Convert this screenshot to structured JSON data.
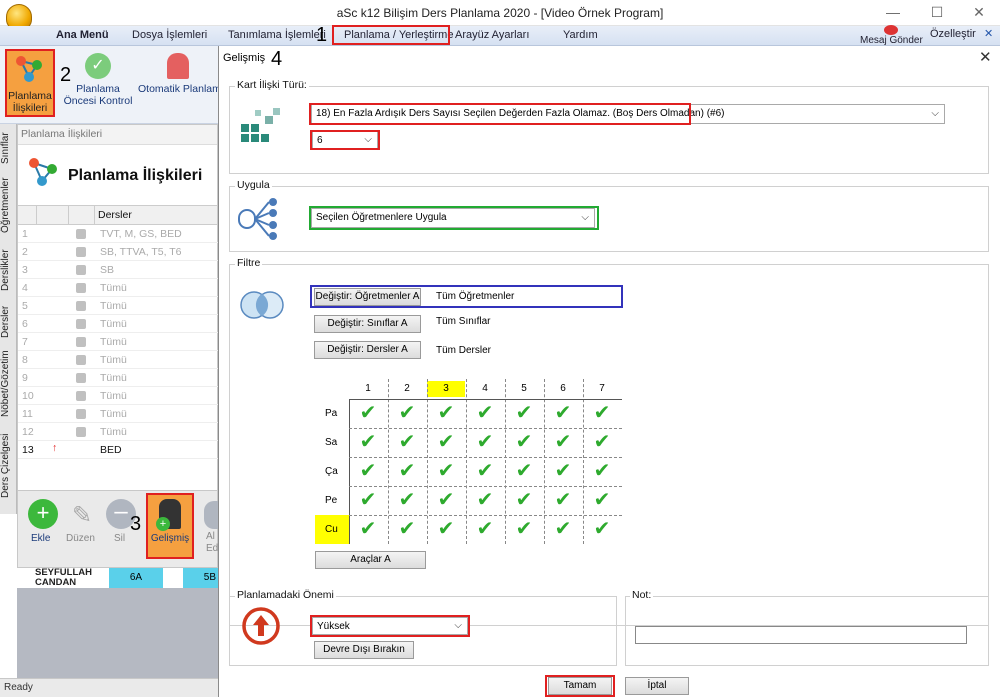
{
  "window": {
    "title": "aSc k12 Bilişim Ders Planlama 2020  - [Video Örnek Program]",
    "minimize": "—",
    "maximize": "☐",
    "close": "✕"
  },
  "menubar": {
    "items": [
      "Ana Menü",
      "Dosya İşlemleri",
      "Tanımlama İşlemleri",
      "Planlama / Yerleştirme",
      "Arayüz Ayarları",
      "Yardım"
    ],
    "send_message": "Mesaj Gönder",
    "customize": "Özelleştir"
  },
  "annotations": {
    "step1": "1",
    "step2": "2",
    "step3": "3",
    "step4": "4"
  },
  "ribbon": {
    "btn1": "Planlama İlişkileri",
    "btn2": "Planlama Öncesi Kontrol",
    "btn3": "Otomatik Planlamayı Başlat"
  },
  "vertical_tabs": [
    "Sınıflar",
    "Öğretmenler",
    "Derslikler",
    "Dersler",
    "Nöbet/Gözetim",
    "Ders Çizelgesi"
  ],
  "left_panel": {
    "header": "Planlama İlişkileri",
    "title": "Planlama İlişkileri",
    "column": "Dersler",
    "rows": [
      {
        "n": "1",
        "text": "TVT, M, GS, BED"
      },
      {
        "n": "2",
        "text": "SB, TTVA, T5, T6"
      },
      {
        "n": "3",
        "text": "SB"
      },
      {
        "n": "4",
        "text": "Tümü"
      },
      {
        "n": "5",
        "text": "Tümü"
      },
      {
        "n": "6",
        "text": "Tümü"
      },
      {
        "n": "7",
        "text": "Tümü"
      },
      {
        "n": "8",
        "text": "Tümü"
      },
      {
        "n": "9",
        "text": "Tümü"
      },
      {
        "n": "10",
        "text": "Tümü"
      },
      {
        "n": "11",
        "text": "Tümü"
      },
      {
        "n": "12",
        "text": "Tümü"
      },
      {
        "n": "13",
        "text": "BED"
      }
    ],
    "buttons": {
      "add": "Ekle",
      "edit": "Düzen",
      "delete": "Sil",
      "advanced": "Gelişmiş",
      "more": "Al Ed"
    }
  },
  "schedule_strip": {
    "teacher": "SEYFULLAH CANDAN",
    "c1": "6A",
    "c2": "5B"
  },
  "status": "Ready",
  "dialog": {
    "title": "Gelişmiş",
    "close": "✕",
    "card_type": {
      "label": "Kart İlişki Türü:",
      "value": "18) En Fazla Ardışık Ders Sayısı Seçilen Değerden Fazla Olamaz. (Boş Ders Olmadan) (#6)",
      "count": "6"
    },
    "apply": {
      "label": "Uygula",
      "value": "Seçilen Öğretmenlere Uygula"
    },
    "filter": {
      "label": "Filtre",
      "rows": [
        {
          "button": "Değiştir: Öğretmenler A",
          "value": "Tüm Öğretmenler"
        },
        {
          "button": "Değiştir: Sınıflar A",
          "value": "Tüm Sınıflar"
        },
        {
          "button": "Değiştir: Dersler A",
          "value": "Tüm Dersler"
        }
      ],
      "periods": [
        "1",
        "2",
        "3",
        "4",
        "5",
        "6",
        "7"
      ],
      "days": [
        "Pa",
        "Sa",
        "Ça",
        "Pe",
        "Cu"
      ],
      "highlight_period": "3",
      "highlight_day": "Cu",
      "check_icon": "✔",
      "tools": "Araçlar A"
    },
    "importance": {
      "label": "Planlamadaki Önemi",
      "value": "Yüksek",
      "disable": "Devre Dışı Bırakın"
    },
    "note": {
      "label": "Not:",
      "value": ""
    },
    "ok": "Tamam",
    "cancel": "İptal"
  }
}
